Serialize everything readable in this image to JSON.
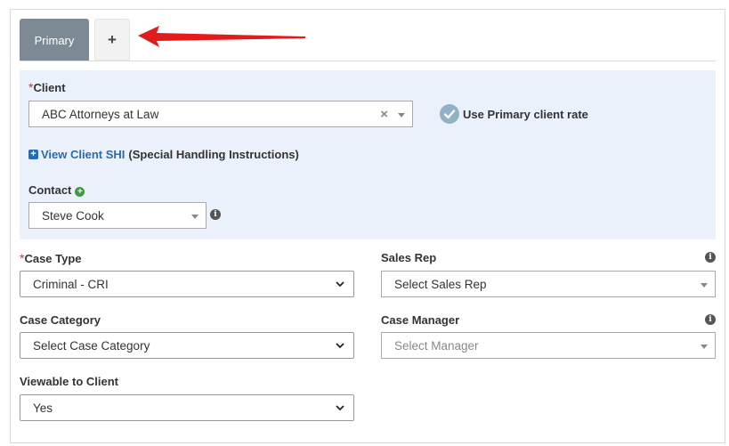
{
  "tabs": {
    "primary_label": "Primary",
    "add_label": "+"
  },
  "client": {
    "label": "Client",
    "required_mark": "*",
    "value": "ABC Attorneys at Law",
    "clear_symbol": "×",
    "use_primary_rate_label": "Use Primary client rate",
    "shi_link": "View Client SHI",
    "shi_paren": "(Special Handling Instructions)"
  },
  "contact": {
    "label": "Contact",
    "value": "Steve Cook"
  },
  "case_type": {
    "label": "Case Type",
    "required_mark": "*",
    "value": "Criminal - CRI"
  },
  "sales_rep": {
    "label": "Sales Rep",
    "value": "Select Sales Rep"
  },
  "case_category": {
    "label": "Case Category",
    "value": "Select Case Category"
  },
  "case_manager": {
    "label": "Case Manager",
    "value": "Select Manager"
  },
  "viewable": {
    "label": "Viewable to Client",
    "value": "Yes"
  },
  "colors": {
    "tab_active": "#7d8a96",
    "client_bg": "#eaf1fb",
    "link": "#2a6bb0",
    "required": "#d9302c",
    "arrow": "#e21b1b"
  },
  "icons": {
    "info": "info-icon",
    "check": "check-icon",
    "plus": "plus-icon",
    "chevron": "chevron-down-icon"
  }
}
